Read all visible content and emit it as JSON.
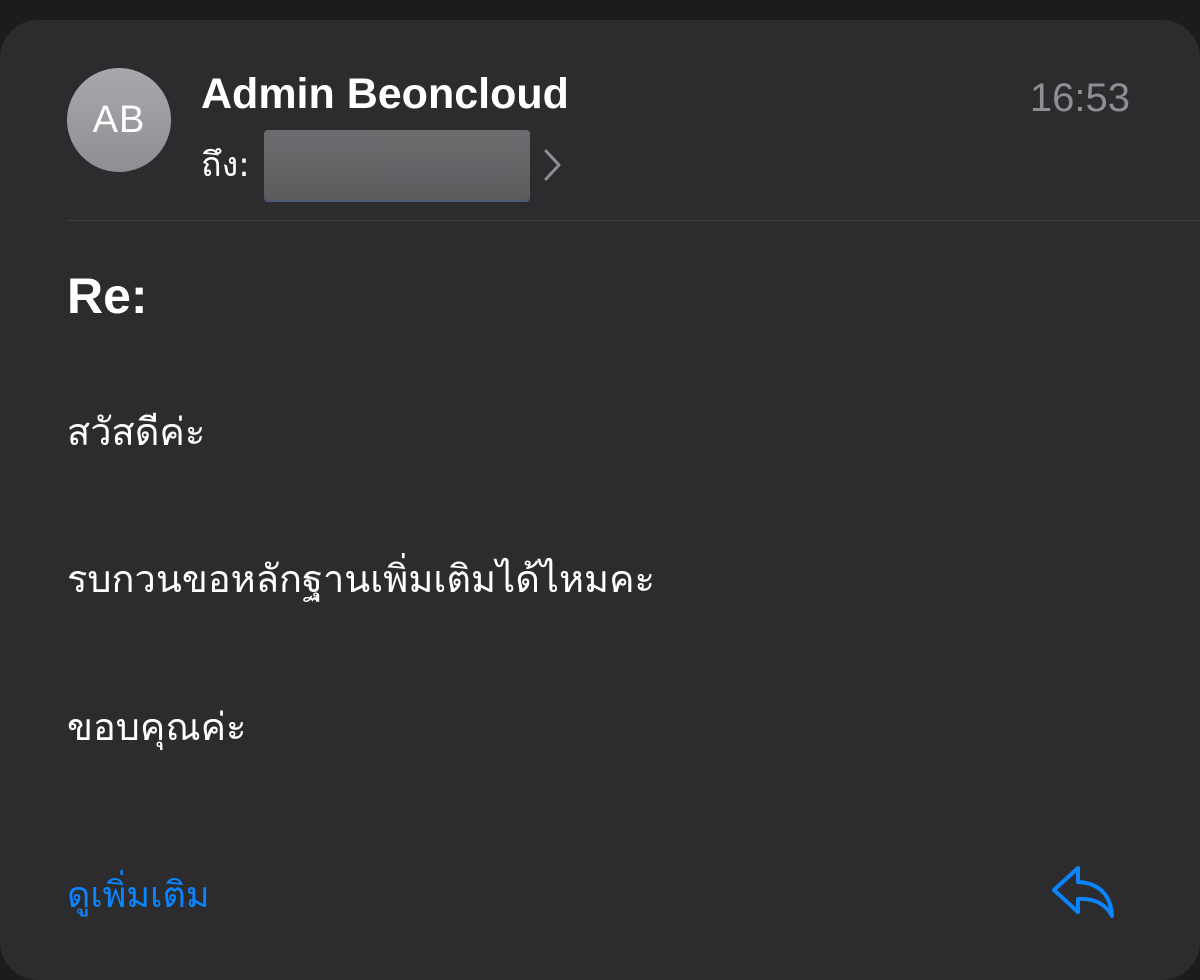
{
  "email": {
    "avatar_initials": "AB",
    "sender_name": "Admin Beoncloud",
    "to_label": "ถึง:",
    "time": "16:53",
    "subject": "Re:",
    "body_lines": [
      "สวัสดีค่ะ",
      "รบกวนขอหลักฐานเพิ่มเติมได้ไหมคะ",
      "ขอบคุณค่ะ"
    ],
    "see_more_label": "ดูเพิ่มเติม"
  },
  "icons": {
    "chevron": "chevron-right-icon",
    "reply": "reply-icon"
  },
  "colors": {
    "background": "#2c2c2e",
    "accent": "#0a84ff",
    "secondary_text": "#8e8e93"
  }
}
